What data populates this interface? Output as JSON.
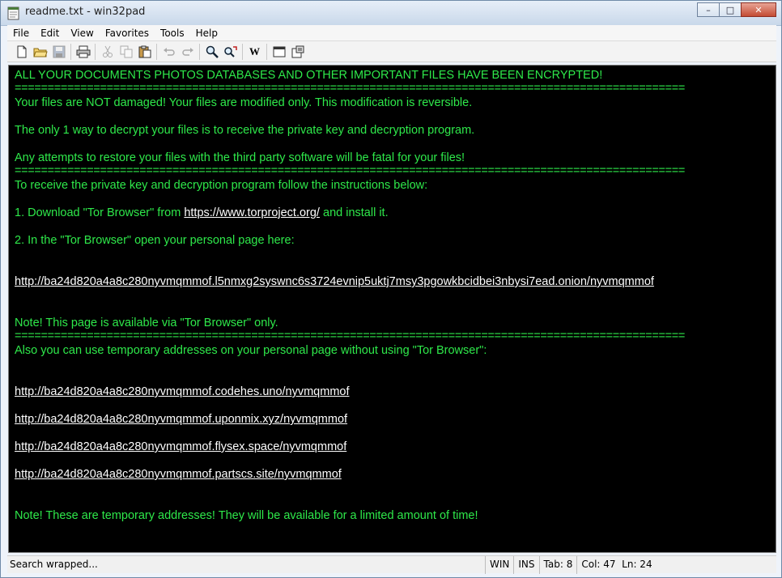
{
  "window": {
    "title": "readme.txt - win32pad",
    "minimize_label": "–",
    "maximize_label": "□",
    "close_label": "✕"
  },
  "menu": [
    "File",
    "Edit",
    "View",
    "Favorites",
    "Tools",
    "Help"
  ],
  "toolbar": {
    "icons": [
      "new-file-icon",
      "open-folder-icon",
      "save-icon",
      "print-icon",
      "cut-icon",
      "copy-icon",
      "paste-icon",
      "undo-icon",
      "redo-icon",
      "find-icon",
      "replace-icon",
      "word-wrap-icon",
      "window-icon",
      "settings-icon"
    ],
    "wrap_label": "W"
  },
  "editor": {
    "lines": [
      "ALL YOUR DOCUMENTS PHOTOS DATABASES AND OTHER IMPORTANT FILES HAVE BEEN ENCRYPTED!",
      "======================================================================================================",
      "Your files are NOT damaged! Your files are modified only. This modification is reversible.",
      "The only 1 way to decrypt your files is to receive the private key and decryption program.",
      "Any attempts to restore your files with the third party software will be fatal for your files!",
      "======================================================================================================",
      "To receive the private key and decryption program follow the instructions below:",
      "1. Download \"Tor Browser\" from",
      "https://www.torproject.org/",
      "and install it.",
      "2. In the \"Tor Browser\" open your personal page here:",
      "http://ba24d820a4a8c280nyvmqmmof.l5nmxg2syswnc6s3724evnip5uktj7msy3pgowkbcidbei3nbysi7ead.onion/nyvmqmmof",
      "Note! This page is available via \"Tor Browser\" only.",
      "======================================================================================================",
      "Also you can use temporary addresses on your personal page without using \"Tor Browser\":",
      "http://ba24d820a4a8c280nyvmqmmof.codehes.uno/nyvmqmmof",
      "http://ba24d820a4a8c280nyvmqmmof.uponmix.xyz/nyvmqmmof",
      "http://ba24d820a4a8c280nyvmqmmof.flysex.space/nyvmqmmof",
      "http://ba24d820a4a8c280nyvmqmmof.partscs.site/nyvmqmmof",
      "Note! These are temporary addresses! They will be available for a limited amount of time!"
    ],
    "text_color": "#2ee84a",
    "link_color": "#ffffff",
    "background": "#000000"
  },
  "status": {
    "message": "Search wrapped...",
    "encoding": "WIN",
    "mode": "INS",
    "tab": "Tab: 8",
    "position": "Col: 47  Ln: 24"
  }
}
